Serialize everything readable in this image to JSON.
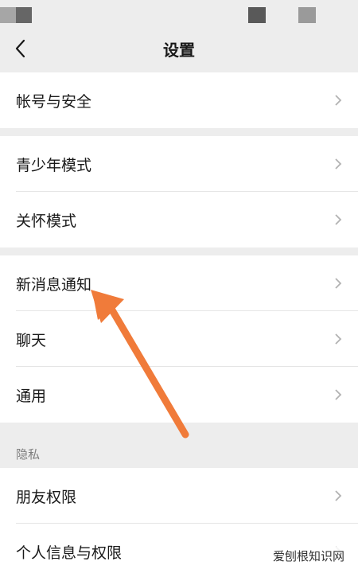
{
  "header": {
    "title": "设置"
  },
  "groups": [
    {
      "items": [
        {
          "label": "帐号与安全"
        }
      ]
    },
    {
      "items": [
        {
          "label": "青少年模式"
        },
        {
          "label": "关怀模式"
        }
      ]
    },
    {
      "items": [
        {
          "label": "新消息通知"
        },
        {
          "label": "聊天"
        },
        {
          "label": "通用"
        }
      ]
    }
  ],
  "privacy": {
    "header": "隐私",
    "items": [
      {
        "label": "朋友权限"
      },
      {
        "label": "个人信息与权限"
      }
    ]
  },
  "annotation": {
    "color": "#f07b3a",
    "points_to": "新消息通知"
  },
  "watermark": "爱刨根知识网",
  "icons": {
    "back": "chevron-left-icon",
    "row": "chevron-right-icon"
  },
  "colors": {
    "background": "#ededed",
    "card": "#ffffff",
    "text": "#191919",
    "chevron": "#b2b2b2",
    "divider": "#e5e5e5"
  }
}
